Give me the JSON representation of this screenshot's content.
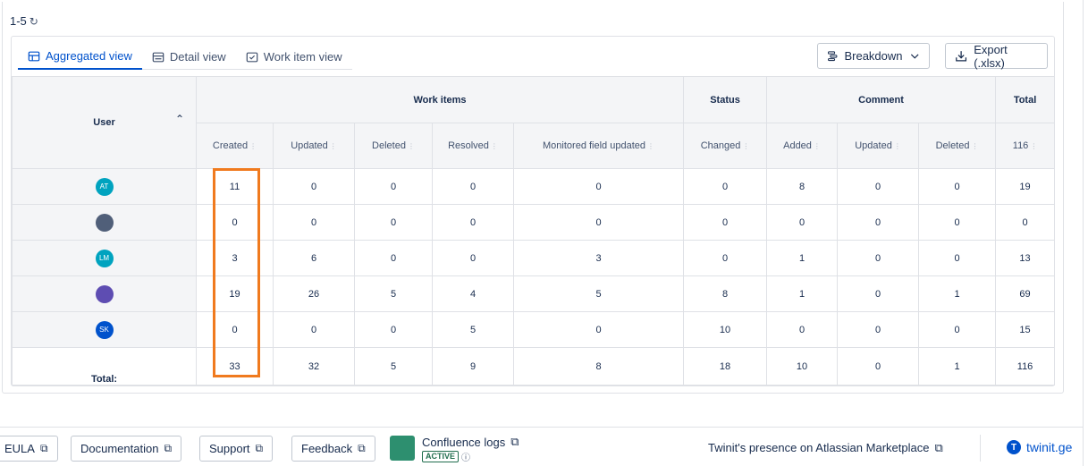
{
  "range": {
    "label": "1-5",
    "refresh_icon": "refresh-icon"
  },
  "tabs": [
    {
      "label": "Aggregated view",
      "icon": "table-icon",
      "active": true
    },
    {
      "label": "Detail view",
      "icon": "list-detail-icon",
      "active": false
    },
    {
      "label": "Work item view",
      "icon": "checkbox-icon",
      "active": false
    }
  ],
  "toolbar": {
    "breakdown_label": "Breakdown",
    "export_label": "Export (.xlsx)"
  },
  "table": {
    "user_header": "User",
    "groups": {
      "work_items": "Work items",
      "status": "Status",
      "comment": "Comment",
      "total": "Total"
    },
    "columns": {
      "created": "Created",
      "updated": "Updated",
      "deleted": "Deleted",
      "resolved": "Resolved",
      "monitored": "Monitored field updated",
      "changed": "Changed",
      "c_added": "Added",
      "c_updated": "Updated",
      "c_deleted": "Deleted",
      "total_count": "116"
    },
    "rows": [
      {
        "avatar": "AT",
        "avatar_color": "#00a3bf",
        "cells": [
          "11",
          "0",
          "0",
          "0",
          "0",
          "0",
          "8",
          "0",
          "0",
          "19"
        ]
      },
      {
        "avatar": "",
        "avatar_color": "#505f79",
        "cells": [
          "0",
          "0",
          "0",
          "0",
          "0",
          "0",
          "0",
          "0",
          "0",
          "0"
        ]
      },
      {
        "avatar": "LM",
        "avatar_color": "#00a3bf",
        "cells": [
          "3",
          "6",
          "0",
          "0",
          "3",
          "0",
          "1",
          "0",
          "0",
          "13"
        ]
      },
      {
        "avatar": "",
        "avatar_color": "#5e4db2",
        "cells": [
          "19",
          "26",
          "5",
          "4",
          "5",
          "8",
          "1",
          "0",
          "1",
          "69"
        ]
      },
      {
        "avatar": "SK",
        "avatar_color": "#0052cc",
        "cells": [
          "0",
          "0",
          "0",
          "5",
          "0",
          "10",
          "0",
          "0",
          "0",
          "15"
        ]
      }
    ],
    "totals_label": "Total:",
    "totals": [
      "33",
      "32",
      "5",
      "9",
      "8",
      "18",
      "10",
      "0",
      "1",
      "116"
    ]
  },
  "footer": {
    "eula": "EULA",
    "documentation": "Documentation",
    "support": "Support",
    "feedback": "Feedback",
    "confluence_logs": "Confluence logs",
    "active_badge": "ACTIVE",
    "marketplace": "Twinit's presence on Atlassian Marketplace",
    "twinit": "twinit.ge"
  },
  "colors": {
    "link": "#0052cc",
    "highlight": "#f07a1e"
  }
}
